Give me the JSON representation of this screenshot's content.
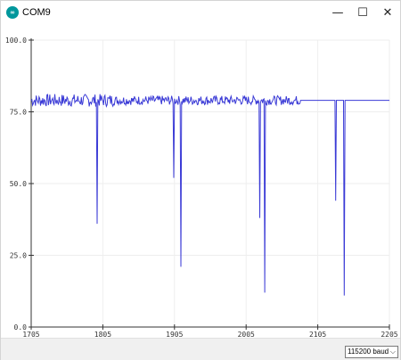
{
  "window": {
    "title": "COM9",
    "icon": "arduino-icon",
    "minimize_label": "—",
    "maximize_label": "☐",
    "close_label": "✕"
  },
  "chart_data": {
    "type": "line",
    "x_range": [
      1705,
      2205
    ],
    "ylim": [
      0,
      100
    ],
    "y_ticks": [
      "0.0",
      "25.0",
      "50.0",
      "75.0",
      "100.0"
    ],
    "x_ticks": [
      "1705",
      "1805",
      "1905",
      "2005",
      "2105",
      "2205"
    ],
    "grid": true,
    "line_color": "#3a3ad6",
    "baseline": 79,
    "noisy_until": 2080,
    "dips": [
      {
        "x": 1797,
        "y": 36
      },
      {
        "x": 1904,
        "y": 52
      },
      {
        "x": 1914,
        "y": 21
      },
      {
        "x": 2024,
        "y": 38
      },
      {
        "x": 2031,
        "y": 12
      },
      {
        "x": 2130,
        "y": 44
      },
      {
        "x": 2142,
        "y": 11
      }
    ],
    "series": [
      {
        "values": "serial-plot"
      }
    ]
  },
  "statusbar": {
    "baud": "115200 baud",
    "baud_arrow": "⌵"
  }
}
